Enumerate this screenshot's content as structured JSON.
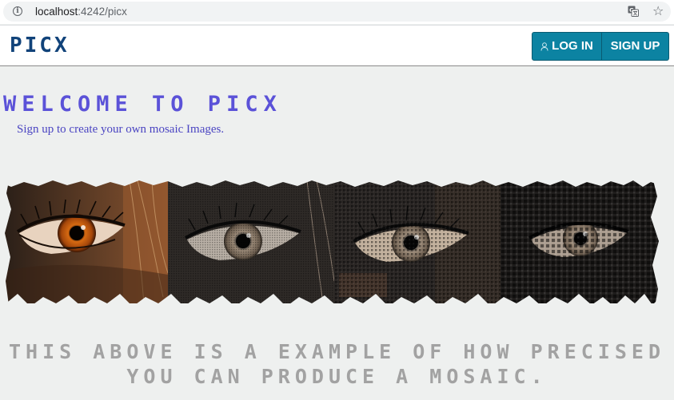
{
  "browser": {
    "url_host": "localhost",
    "url_path": ":4242/picx",
    "icons": [
      "info-icon",
      "translate-icon",
      "star-icon"
    ]
  },
  "navbar": {
    "brand": "PICX",
    "login_label": "LOG IN",
    "signup_label": "SIGN UP",
    "button_color": "#0c83a2",
    "brand_color": "#11437a"
  },
  "main": {
    "title": "WELCOME TO PICX",
    "subtitle": "Sign up to create your own mosaic Images.",
    "title_color": "#5b52d8",
    "banner": {
      "panels": [
        "original-eye",
        "mosaic-level-1",
        "mosaic-level-2",
        "mosaic-level-3"
      ]
    },
    "caption_line1": "THIS ABOVE IS A EXAMPLE OF HOW PRECISED",
    "caption_line2": "YOU CAN PRODUCE A MOSAIC."
  }
}
